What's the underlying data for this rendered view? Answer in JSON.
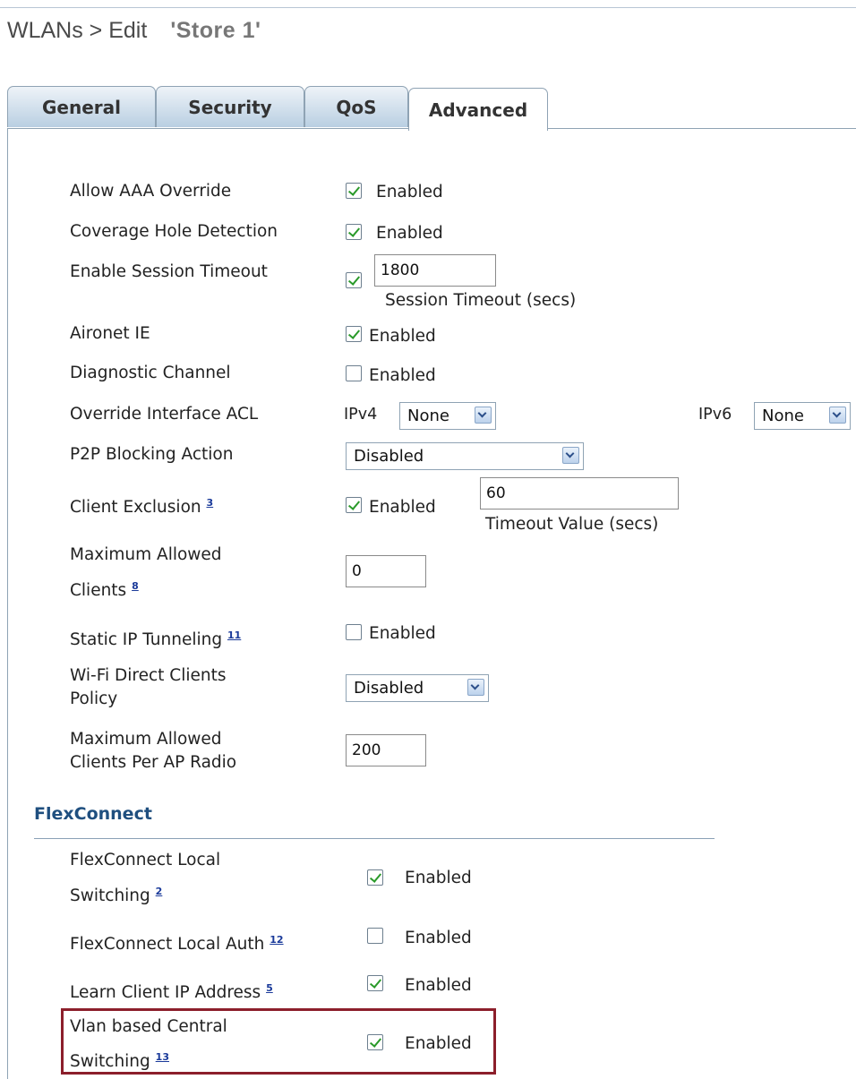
{
  "breadcrumb": {
    "prefix": "WLANs > Edit",
    "name": "'Store 1'"
  },
  "tabs": [
    {
      "label": "General"
    },
    {
      "label": "Security"
    },
    {
      "label": "QoS"
    },
    {
      "label": "Advanced",
      "active": true
    }
  ],
  "settings": {
    "allow_aaa_override": {
      "label": "Allow AAA Override",
      "checked": true,
      "text": "Enabled"
    },
    "coverage_hole": {
      "label": "Coverage Hole Detection",
      "checked": true,
      "text": "Enabled"
    },
    "session_timeout": {
      "label": "Enable Session Timeout",
      "checked": true,
      "value": "1800",
      "caption": "Session Timeout (secs)"
    },
    "aironet_ie": {
      "label": "Aironet IE",
      "checked": true,
      "text": "Enabled"
    },
    "diagnostic_channel": {
      "label": "Diagnostic Channel",
      "checked": false,
      "text": "Enabled"
    },
    "override_acl": {
      "label": "Override Interface ACL",
      "ipv4_label": "IPv4",
      "ipv4_value": "None",
      "ipv6_label": "IPv6",
      "ipv6_value": "None"
    },
    "p2p_blocking": {
      "label": "P2P Blocking Action",
      "value": "Disabled"
    },
    "client_exclusion": {
      "label": "Client Exclusion",
      "note": "3",
      "checked": true,
      "text": "Enabled",
      "value": "60",
      "caption": "Timeout Value (secs)"
    },
    "max_clients": {
      "label_line1": "Maximum Allowed",
      "label_line2": "Clients",
      "note": "8",
      "value": "0"
    },
    "static_ip": {
      "label": "Static IP Tunneling",
      "note": "11",
      "checked": false,
      "text": "Enabled"
    },
    "wifi_direct": {
      "label_line1": "Wi-Fi Direct Clients",
      "label_line2": "Policy",
      "value": "Disabled"
    },
    "max_clients_radio": {
      "label_line1": "Maximum Allowed",
      "label_line2": "Clients Per AP Radio",
      "value": "200"
    }
  },
  "flexconnect": {
    "title": "FlexConnect",
    "local_switching": {
      "label_line1": "FlexConnect Local",
      "label_line2": "Switching",
      "note": "2",
      "checked": true,
      "text": "Enabled"
    },
    "local_auth": {
      "label": "FlexConnect Local Auth",
      "note": "12",
      "checked": false,
      "text": "Enabled"
    },
    "learn_ip": {
      "label": "Learn Client IP Address",
      "note": "5",
      "checked": true,
      "text": "Enabled"
    },
    "vlan_central": {
      "label_line1": "Vlan based Central",
      "label_line2": "Switching",
      "note": "13",
      "checked": true,
      "text": "Enabled"
    }
  },
  "colors": {
    "highlight_border": "#8c1f2b",
    "section_title": "#1f4f7f",
    "check": "#2a9a2a"
  }
}
